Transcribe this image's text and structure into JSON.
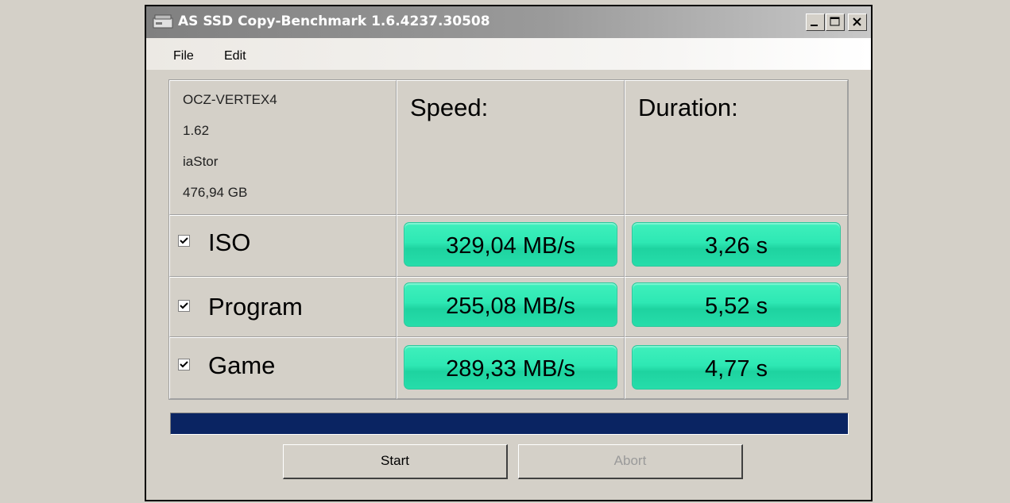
{
  "window": {
    "title": "AS SSD Copy-Benchmark 1.6.4237.30508",
    "caption_buttons": {
      "minimize": "minimize-icon",
      "maximize": "maximize-icon",
      "close": "close-icon"
    }
  },
  "menu": {
    "file": "File",
    "edit": "Edit"
  },
  "drive_info": {
    "model": "OCZ-VERTEX4",
    "firmware": "1.62",
    "driver": "iaStor",
    "capacity": "476,94 GB"
  },
  "headers": {
    "speed": "Speed:",
    "duration": "Duration:"
  },
  "tests": [
    {
      "label": "ISO",
      "checked": true,
      "speed": "329,04 MB/s",
      "duration": "3,26 s"
    },
    {
      "label": "Program",
      "checked": true,
      "speed": "255,08 MB/s",
      "duration": "5,52 s"
    },
    {
      "label": "Game",
      "checked": true,
      "speed": "289,33 MB/s",
      "duration": "4,77 s"
    }
  ],
  "progress": {
    "fraction": 1.0
  },
  "buttons": {
    "start": "Start",
    "abort": "Abort"
  },
  "colors": {
    "result_fill": "#2ee8b4",
    "progress_fill": "#0a2462",
    "window_bg": "#d4d0c8"
  }
}
